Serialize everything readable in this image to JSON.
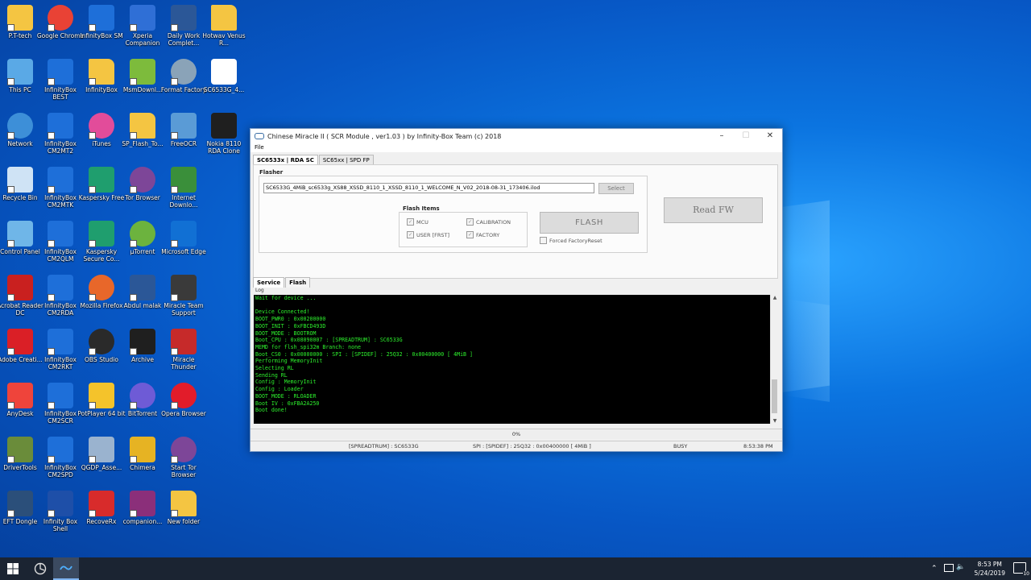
{
  "desktop": {
    "col1": [
      {
        "label": "P.T-tech",
        "icon": "person-folder-icon",
        "color": "#f4c542"
      },
      {
        "label": "This PC",
        "icon": "computer-icon",
        "color": "#5aa9e6"
      },
      {
        "label": "Network",
        "icon": "network-globe-icon",
        "color": "#3d8fd8"
      },
      {
        "label": "Recycle Bin",
        "icon": "recycle-bin-icon",
        "color": "#cfe3f5"
      },
      {
        "label": "Control Panel",
        "icon": "control-panel-icon",
        "color": "#6fb6e8"
      },
      {
        "label": "Acrobat Reader DC",
        "icon": "acrobat-icon",
        "color": "#c9201f"
      },
      {
        "label": "Adobe Creati...",
        "icon": "creative-cloud-icon",
        "color": "#da1f26"
      },
      {
        "label": "AnyDesk",
        "icon": "anydesk-icon",
        "color": "#ef443b"
      },
      {
        "label": "DriverTools",
        "icon": "driver-tools-icon",
        "color": "#6a8c3a"
      },
      {
        "label": "EFT Dongle",
        "icon": "eft-dongle-icon",
        "color": "#2b4f7a"
      }
    ],
    "col2": [
      {
        "label": "Google Chrome",
        "icon": "chrome-icon",
        "color": "#e94235"
      },
      {
        "label": "InfinityBox BEST",
        "icon": "infinitybox-icon",
        "color": "#1e6fd9"
      },
      {
        "label": "InfinityBox CM2MT2",
        "icon": "infinitybox-icon",
        "color": "#1e6fd9"
      },
      {
        "label": "InfinityBox CM2MTK",
        "icon": "infinitybox-icon",
        "color": "#1e6fd9"
      },
      {
        "label": "InfinityBox CM2QLM",
        "icon": "infinitybox-icon",
        "color": "#1e6fd9"
      },
      {
        "label": "InfinityBox CM2RDA",
        "icon": "infinitybox-icon",
        "color": "#1e6fd9"
      },
      {
        "label": "InfinityBox CM2RKT",
        "icon": "infinitybox-icon",
        "color": "#1e6fd9"
      },
      {
        "label": "InfinityBox CM2SCR",
        "icon": "infinitybox-icon",
        "color": "#1e6fd9"
      },
      {
        "label": "InfinityBox CM2SPD",
        "icon": "infinitybox-icon",
        "color": "#1e6fd9"
      },
      {
        "label": "Infinity Box Shell",
        "icon": "infinity-shell-icon",
        "color": "#1e4fa8"
      }
    ],
    "col3": [
      {
        "label": "InfinityBox SM",
        "icon": "infinitybox-icon",
        "color": "#1e6fd9"
      },
      {
        "label": "InfinityBox",
        "icon": "folder-icon",
        "color": "#f4c542"
      },
      {
        "label": "iTunes",
        "icon": "itunes-icon",
        "color": "#e24c9a"
      },
      {
        "label": "Kaspersky Free",
        "icon": "kaspersky-icon",
        "color": "#1f9e6e"
      },
      {
        "label": "Kaspersky Secure Co...",
        "icon": "kaspersky-icon",
        "color": "#1f9e6e"
      },
      {
        "label": "Mozilla Firefox",
        "icon": "firefox-icon",
        "color": "#e8672a"
      },
      {
        "label": "OBS Studio",
        "icon": "obs-icon",
        "color": "#2a2a2a"
      },
      {
        "label": "PotPlayer 64 bit",
        "icon": "potplayer-icon",
        "color": "#f4c32b"
      },
      {
        "label": "QGDP_Asse...",
        "icon": "qgdp-icon",
        "color": "#9ab3cf"
      },
      {
        "label": "RecoveRx",
        "icon": "recoverx-icon",
        "color": "#d82b2b"
      }
    ],
    "col4": [
      {
        "label": "Xperia Companion",
        "icon": "xperia-icon",
        "color": "#2f6fd6"
      },
      {
        "label": "MsmDownl...",
        "icon": "msm-download-icon",
        "color": "#7dbb3c"
      },
      {
        "label": "SP_Flash_To...",
        "icon": "folder-icon",
        "color": "#f4c542"
      },
      {
        "label": "Tor Browser",
        "icon": "tor-icon",
        "color": "#7d4698"
      },
      {
        "label": "µTorrent",
        "icon": "utorrent-icon",
        "color": "#6cb33e"
      },
      {
        "label": "Abdul malak",
        "icon": "word-icon",
        "color": "#2b5797"
      },
      {
        "label": "Archive",
        "icon": "7zip-icon",
        "color": "#1f1f1f"
      },
      {
        "label": "BitTorrent",
        "icon": "bittorrent-icon",
        "color": "#6e5bd6"
      },
      {
        "label": "Chimera",
        "icon": "chimera-icon",
        "color": "#e6b323"
      },
      {
        "label": "companion...",
        "icon": "winrar-icon",
        "color": "#8b2f7a"
      }
    ],
    "col5": [
      {
        "label": "Daily Work Complet...",
        "icon": "word-doc-icon",
        "color": "#2b5797"
      },
      {
        "label": "Format Factory",
        "icon": "format-factory-icon",
        "color": "#8aa3b8"
      },
      {
        "label": "FreeOCR",
        "icon": "freeocr-icon",
        "color": "#5a9bd6"
      },
      {
        "label": "Internet Downlo...",
        "icon": "idm-icon",
        "color": "#3a8f3a"
      },
      {
        "label": "Microsoft Edge",
        "icon": "edge-icon",
        "color": "#1170d4"
      },
      {
        "label": "Miracle Team Support",
        "icon": "miracle-team-icon",
        "color": "#3a3a3a"
      },
      {
        "label": "Miracle Thunder",
        "icon": "miracle-thunder-icon",
        "color": "#c62a2a"
      },
      {
        "label": "Opera Browser",
        "icon": "opera-icon",
        "color": "#e21c2a"
      },
      {
        "label": "Start Tor Browser",
        "icon": "tor-icon",
        "color": "#7d4698"
      },
      {
        "label": "New folder",
        "icon": "folder-icon",
        "color": "#f4c542"
      }
    ],
    "col6": [
      {
        "label": "Hotwav Venus R...",
        "icon": "folder-icon",
        "color": "#f4c542"
      },
      {
        "label": "SC6533G_4...",
        "icon": "file-icon",
        "color": "#ffffff"
      },
      {
        "label": "Nokia 8110 RDA Clone",
        "icon": "7zip-icon",
        "color": "#1f1f1f"
      }
    ]
  },
  "window": {
    "title": "Chinese Miracle II ( SCR Module , ver1.03  ) by Infinity-Box Team (c) 2018",
    "menu_file": "File",
    "tabs": [
      "SC6533x | RDA SC",
      "SC65xx | SPD FP"
    ],
    "flasher_label": "Flasher",
    "file_path": "SC6533G_4MiB_sc6533g_XS88_XSSD_8110_1_XSSD_8110_1_WELCOME_N_V02_2018-08-31_173406.ilod",
    "select_label": "Select",
    "flash_items_label": "Flash Items",
    "items": [
      "MCU",
      "CALIBRATION",
      "USER [FRST]",
      "FACTORY"
    ],
    "flash_button": "FLASH",
    "forced_reset": "Forced FactoryReset",
    "read_fw": "Read FW",
    "bottom_tabs": [
      "Service",
      "Flash"
    ],
    "log_label": "Log",
    "log_lines": [
      "Wait for device ...",
      "",
      "Device Connected!",
      "BOOT_PWR0 : 0x00200000",
      "BOOT_INIT : 0xFBCD493D",
      "BOOT_MODE : BOOTROM",
      "Boot_CPU  : 0x08090007 : [SPREADTRUM] : SC6533G",
      "MEMD for flsh_spi32m Branch: none",
      "Boot_CS0 : 0x00000000 : SPI : [SPIDEF] : 25Q32 : 0x00400000 [ 4MiB ]",
      "Performing MemoryInit",
      "Selecting RL",
      "Sending RL",
      "Config : MemoryInit",
      "Config : Loader",
      "BOOT_MODE : RLOADER",
      "Boot IV  : 0xFBA2A250",
      "Boot done!"
    ],
    "progress": "0%",
    "status": {
      "chip": "[SPREADTRUM] : SC6533G",
      "flash": "SPI : [SPIDEF] : 25Q32 : 0x00400000 [ 4MiB ]",
      "state": "BUSY",
      "time": "8:53:38 PM"
    }
  },
  "taskbar": {
    "time": "8:53 PM",
    "date": "5/24/2019",
    "notification_count": "10"
  }
}
